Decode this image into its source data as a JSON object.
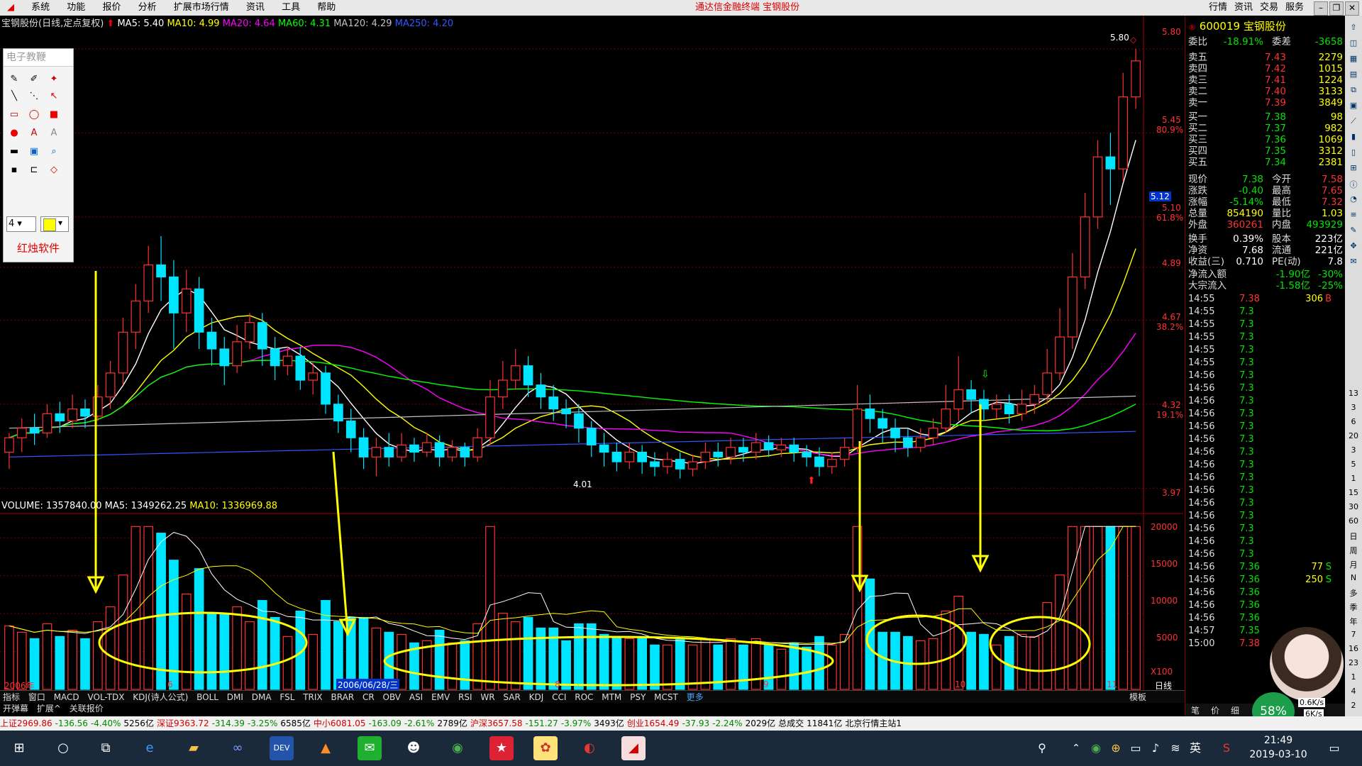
{
  "menubar": {
    "items": [
      "系统",
      "功能",
      "报价",
      "分析",
      "扩展市场行情",
      "资讯",
      "工具",
      "帮助"
    ],
    "center_text": "通达信金融终端  宝钢股份",
    "right_items": [
      "行情",
      "资讯",
      "交易",
      "服务"
    ]
  },
  "chart_header": {
    "title": "宝钢股份(日线,定点复权)",
    "ma5": "MA5: 5.40",
    "ma10": "MA10: 4.99",
    "ma20": "MA20: 4.64",
    "ma60": "MA60: 4.31",
    "ma120": "MA120: 4.29",
    "ma250": "MA250: 4.20",
    "colors": {
      "ma5": "#ffffff",
      "ma10": "#ffff00",
      "ma20": "#ff00ff",
      "ma60": "#00ff00",
      "ma120": "#c0c0c0",
      "ma250": "#3355ff"
    }
  },
  "volume_header": {
    "volume": "VOLUME: 1357840.00",
    "ma5": "MA5: 1349262.25",
    "ma10": "MA10: 1336969.88"
  },
  "price_axis": {
    "labels": [
      "5.80",
      "5.45",
      "80.9%",
      "5.12",
      "5.10",
      "61.8%",
      "4.89",
      "4.67",
      "38.2%",
      "4.32",
      "19.1%",
      "3.97"
    ],
    "peak_label": "5.80",
    "low_label": "4.01"
  },
  "volume_axis": {
    "labels": [
      "20000",
      "15000",
      "10000",
      "5000",
      "X100"
    ]
  },
  "date_axis": {
    "labels": [
      "2006年",
      "6",
      "2006/06/28/三",
      "8",
      "9",
      "10",
      "11"
    ],
    "right_label": "日线"
  },
  "draw_toolbar": {
    "title": "电子教鞭",
    "line_width": "4",
    "brand": "红烛软件"
  },
  "quote": {
    "stock_code": "600019",
    "stock_name": "宝钢股份",
    "weibi_label": "委比",
    "weibi": "-18.91%",
    "weicha_label": "委差",
    "weicha": "-3658",
    "sell": [
      {
        "label": "卖五",
        "price": "7.43",
        "vol": "2279"
      },
      {
        "label": "卖四",
        "price": "7.42",
        "vol": "1015"
      },
      {
        "label": "卖三",
        "price": "7.41",
        "vol": "1224"
      },
      {
        "label": "卖二",
        "price": "7.40",
        "vol": "3133"
      },
      {
        "label": "卖一",
        "price": "7.39",
        "vol": "3849"
      }
    ],
    "buy": [
      {
        "label": "买一",
        "price": "7.38",
        "vol": "98"
      },
      {
        "label": "买二",
        "price": "7.37",
        "vol": "982"
      },
      {
        "label": "买三",
        "price": "7.36",
        "vol": "1069"
      },
      {
        "label": "买四",
        "price": "7.35",
        "vol": "3312"
      },
      {
        "label": "买五",
        "price": "7.34",
        "vol": "2381"
      }
    ],
    "stats": [
      {
        "l1": "现价",
        "v1": "7.38",
        "l2": "今开",
        "v2": "7.58"
      },
      {
        "l1": "涨跌",
        "v1": "-0.40",
        "l2": "最高",
        "v2": "7.65"
      },
      {
        "l1": "涨幅",
        "v1": "-5.14%",
        "l2": "最低",
        "v2": "7.32"
      },
      {
        "l1": "总量",
        "v1": "854190",
        "l2": "量比",
        "v2": "1.03"
      },
      {
        "l1": "外盘",
        "v1": "360261",
        "l2": "内盘",
        "v2": "493929"
      },
      {
        "l1": "换手",
        "v1": "0.39%",
        "l2": "股本",
        "v2": "223亿"
      },
      {
        "l1": "净资",
        "v1": "7.68",
        "l2": "流通",
        "v2": "221亿"
      },
      {
        "l1": "收益(三)",
        "v1": "0.710",
        "l2": "PE(动)",
        "v2": "7.8"
      }
    ],
    "flow": [
      {
        "l": "净流入额",
        "v": "-1.90亿",
        "p": "-30%"
      },
      {
        "l": "大宗流入",
        "v": "-1.58亿",
        "p": "-25%"
      }
    ],
    "ticks": [
      {
        "t": "14:55",
        "p": "7.38",
        "v": "306",
        "f": "B"
      },
      {
        "t": "14:55",
        "p": "7.3",
        "v": "",
        "f": ""
      },
      {
        "t": "14:55",
        "p": "7.3",
        "v": "",
        "f": ""
      },
      {
        "t": "14:55",
        "p": "7.3",
        "v": "",
        "f": ""
      },
      {
        "t": "14:55",
        "p": "7.3",
        "v": "",
        "f": ""
      },
      {
        "t": "14:55",
        "p": "7.3",
        "v": "",
        "f": ""
      },
      {
        "t": "14:56",
        "p": "7.3",
        "v": "",
        "f": ""
      },
      {
        "t": "14:56",
        "p": "7.3",
        "v": "",
        "f": ""
      },
      {
        "t": "14:56",
        "p": "7.3",
        "v": "",
        "f": ""
      },
      {
        "t": "14:56",
        "p": "7.3",
        "v": "",
        "f": ""
      },
      {
        "t": "14:56",
        "p": "7.3",
        "v": "",
        "f": ""
      },
      {
        "t": "14:56",
        "p": "7.3",
        "v": "",
        "f": ""
      },
      {
        "t": "14:56",
        "p": "7.3",
        "v": "",
        "f": ""
      },
      {
        "t": "14:56",
        "p": "7.3",
        "v": "",
        "f": ""
      },
      {
        "t": "14:56",
        "p": "7.3",
        "v": "",
        "f": ""
      },
      {
        "t": "14:56",
        "p": "7.3",
        "v": "",
        "f": ""
      },
      {
        "t": "14:56",
        "p": "7.3",
        "v": "",
        "f": ""
      },
      {
        "t": "14:56",
        "p": "7.3",
        "v": "",
        "f": ""
      },
      {
        "t": "14:56",
        "p": "7.3",
        "v": "",
        "f": ""
      },
      {
        "t": "14:56",
        "p": "7.3",
        "v": "",
        "f": ""
      },
      {
        "t": "14:56",
        "p": "7.3",
        "v": "",
        "f": ""
      },
      {
        "t": "14:56",
        "p": "7.36",
        "v": "77",
        "f": "S"
      },
      {
        "t": "14:56",
        "p": "7.36",
        "v": "250",
        "f": "S"
      },
      {
        "t": "14:56",
        "p": "7.36",
        "v": "",
        "f": ""
      },
      {
        "t": "14:56",
        "p": "7.36",
        "v": "",
        "f": ""
      },
      {
        "t": "14:56",
        "p": "7.36",
        "v": "",
        "f": ""
      },
      {
        "t": "14:57",
        "p": "7.35",
        "v": "",
        "f": ""
      },
      {
        "t": "15:00",
        "p": "7.38",
        "v": "",
        "f": ""
      }
    ],
    "tick_right": [
      "13",
      "3",
      "6",
      "20",
      "3",
      "5",
      "1",
      "15",
      "30",
      "60",
      "日",
      "周",
      "月",
      "N",
      "多",
      "季",
      "年",
      "7",
      "16",
      "23",
      "1",
      "4",
      "2"
    ],
    "bottom_tabs": [
      "笔",
      "价",
      "细"
    ],
    "net_speed_up": "0.6K/s",
    "net_speed_down": "6K/s",
    "cpu_pct": "58%"
  },
  "tabbar": {
    "items": [
      "指标",
      "窗口",
      "MACD",
      "VOL-TDX",
      "KDJ(诗人公式)",
      "BOLL",
      "DMI",
      "DMA",
      "FSL",
      "TRIX",
      "BRAR",
      "CR",
      "OBV",
      "ASI",
      "EMV",
      "RSI",
      "WR",
      "SAR",
      "KDJ",
      "CCI",
      "ROC",
      "MTM",
      "PSY",
      "MCST",
      "更多"
    ],
    "right": "模板"
  },
  "tabbar2": {
    "items": [
      "开弹幕",
      "扩展^",
      "关联报价"
    ]
  },
  "statusline": {
    "items": [
      {
        "text": "上证2969.86",
        "c": "red"
      },
      {
        "text": "-136.56",
        "c": "green"
      },
      {
        "text": "-4.40%",
        "c": "green"
      },
      {
        "text": "5256亿",
        "c": "black"
      },
      {
        "text": "深证9363.72",
        "c": "red"
      },
      {
        "text": "-314.39",
        "c": "green"
      },
      {
        "text": "-3.25%",
        "c": "green"
      },
      {
        "text": "6585亿",
        "c": "black"
      },
      {
        "text": "中小6081.05",
        "c": "red"
      },
      {
        "text": "-163.09",
        "c": "green"
      },
      {
        "text": "-2.61%",
        "c": "green"
      },
      {
        "text": "2789亿",
        "c": "black"
      },
      {
        "text": "沪深3657.58",
        "c": "red"
      },
      {
        "text": "-151.27",
        "c": "green"
      },
      {
        "text": "-3.97%",
        "c": "green"
      },
      {
        "text": "3493亿",
        "c": "black"
      },
      {
        "text": "创业1654.49",
        "c": "red"
      },
      {
        "text": "-37.93",
        "c": "green"
      },
      {
        "text": "-2.24%",
        "c": "green"
      },
      {
        "text": "2029亿",
        "c": "black"
      },
      {
        "text": "总成交",
        "c": "black"
      },
      {
        "text": "11841亿",
        "c": "black"
      },
      {
        "text": "北京行情主站1",
        "c": "black"
      }
    ]
  },
  "taskbar": {
    "time": "21:49",
    "date": "2019-03-10",
    "ime": "英"
  },
  "chart_data": {
    "type": "candlestick",
    "price_range": [
      3.97,
      5.8
    ],
    "candles": [
      [
        4.12,
        4.18,
        4.05,
        4.2
      ],
      [
        4.18,
        4.22,
        4.12,
        4.26
      ],
      [
        4.22,
        4.2,
        4.15,
        4.28
      ],
      [
        4.2,
        4.28,
        4.18,
        4.32
      ],
      [
        4.28,
        4.25,
        4.2,
        4.33
      ],
      [
        4.25,
        4.3,
        4.22,
        4.36
      ],
      [
        4.3,
        4.27,
        4.22,
        4.34
      ],
      [
        4.27,
        4.35,
        4.25,
        4.4
      ],
      [
        4.35,
        4.45,
        4.3,
        4.5
      ],
      [
        4.45,
        4.62,
        4.4,
        4.68
      ],
      [
        4.62,
        4.75,
        4.55,
        4.82
      ],
      [
        4.75,
        4.9,
        4.7,
        4.98
      ],
      [
        4.9,
        4.85,
        4.75,
        5.02
      ],
      [
        4.85,
        4.7,
        4.55,
        4.92
      ],
      [
        4.7,
        4.8,
        4.62,
        4.88
      ],
      [
        4.8,
        4.62,
        4.55,
        4.85
      ],
      [
        4.62,
        4.55,
        4.48,
        4.68
      ],
      [
        4.55,
        4.48,
        4.4,
        4.6
      ],
      [
        4.48,
        4.58,
        4.45,
        4.65
      ],
      [
        4.58,
        4.66,
        4.55,
        4.7
      ],
      [
        4.66,
        4.55,
        4.48,
        4.7
      ],
      [
        4.55,
        4.48,
        4.42,
        4.6
      ],
      [
        4.48,
        4.52,
        4.44,
        4.56
      ],
      [
        4.52,
        4.42,
        4.38,
        4.56
      ],
      [
        4.42,
        4.45,
        4.36,
        4.5
      ],
      [
        4.45,
        4.32,
        4.28,
        4.48
      ],
      [
        4.32,
        4.25,
        4.2,
        4.36
      ],
      [
        4.25,
        4.18,
        4.12,
        4.3
      ],
      [
        4.18,
        4.1,
        4.05,
        4.22
      ],
      [
        4.1,
        4.14,
        4.02,
        4.18
      ],
      [
        4.14,
        4.1,
        4.06,
        4.2
      ],
      [
        4.1,
        4.15,
        4.08,
        4.2
      ],
      [
        4.15,
        4.12,
        4.08,
        4.18
      ],
      [
        4.12,
        4.16,
        4.1,
        4.2
      ],
      [
        4.16,
        4.1,
        4.06,
        4.19
      ],
      [
        4.1,
        4.14,
        4.08,
        4.17
      ],
      [
        4.14,
        4.1,
        4.06,
        4.16
      ],
      [
        4.1,
        4.18,
        4.08,
        4.22
      ],
      [
        4.18,
        4.35,
        4.15,
        4.42
      ],
      [
        4.35,
        4.42,
        4.3,
        4.5
      ],
      [
        4.42,
        4.48,
        4.38,
        4.55
      ],
      [
        4.48,
        4.4,
        4.35,
        4.52
      ],
      [
        4.4,
        4.35,
        4.3,
        4.45
      ],
      [
        4.35,
        4.3,
        4.25,
        4.4
      ],
      [
        4.3,
        4.28,
        4.22,
        4.34
      ],
      [
        4.28,
        4.22,
        4.16,
        4.32
      ],
      [
        4.22,
        4.15,
        4.1,
        4.25
      ],
      [
        4.15,
        4.12,
        4.06,
        4.2
      ],
      [
        4.12,
        4.08,
        4.04,
        4.16
      ],
      [
        4.08,
        4.12,
        4.05,
        4.16
      ],
      [
        4.12,
        4.08,
        4.03,
        4.15
      ],
      [
        4.08,
        4.06,
        4.02,
        4.12
      ],
      [
        4.06,
        4.09,
        4.03,
        4.12
      ],
      [
        4.09,
        4.05,
        4.01,
        4.12
      ],
      [
        4.05,
        4.08,
        4.02,
        4.11
      ],
      [
        4.08,
        4.12,
        4.05,
        4.16
      ],
      [
        4.12,
        4.1,
        4.06,
        4.16
      ],
      [
        4.1,
        4.14,
        4.07,
        4.18
      ],
      [
        4.14,
        4.12,
        4.08,
        4.18
      ],
      [
        4.12,
        4.16,
        4.09,
        4.2
      ],
      [
        4.16,
        4.13,
        4.1,
        4.19
      ],
      [
        4.13,
        4.15,
        4.1,
        4.18
      ],
      [
        4.15,
        4.12,
        4.08,
        4.18
      ],
      [
        4.12,
        4.1,
        4.06,
        4.15
      ],
      [
        4.1,
        4.06,
        4.02,
        4.14
      ],
      [
        4.06,
        4.09,
        4.03,
        4.12
      ],
      [
        4.09,
        4.14,
        4.06,
        4.18
      ],
      [
        4.14,
        4.3,
        4.12,
        4.4
      ],
      [
        4.3,
        4.26,
        4.2,
        4.36
      ],
      [
        4.26,
        4.22,
        4.16,
        4.3
      ],
      [
        4.22,
        4.18,
        4.12,
        4.26
      ],
      [
        4.18,
        4.14,
        4.1,
        4.22
      ],
      [
        4.14,
        4.18,
        4.12,
        4.22
      ],
      [
        4.18,
        4.22,
        4.15,
        4.26
      ],
      [
        4.22,
        4.3,
        4.2,
        4.4
      ],
      [
        4.3,
        4.38,
        4.25,
        4.52
      ],
      [
        4.38,
        4.34,
        4.28,
        4.42
      ],
      [
        4.34,
        4.3,
        4.25,
        4.38
      ],
      [
        4.3,
        4.32,
        4.26,
        4.36
      ],
      [
        4.32,
        4.28,
        4.24,
        4.36
      ],
      [
        4.28,
        4.32,
        4.25,
        4.38
      ],
      [
        4.32,
        4.36,
        4.28,
        4.4
      ],
      [
        4.36,
        4.45,
        4.32,
        4.55
      ],
      [
        4.45,
        4.6,
        4.42,
        4.72
      ],
      [
        4.6,
        4.85,
        4.55,
        4.95
      ],
      [
        4.85,
        5.1,
        4.8,
        5.2
      ],
      [
        5.1,
        5.35,
        5.05,
        5.42
      ],
      [
        5.35,
        5.3,
        5.15,
        5.45
      ],
      [
        5.3,
        5.6,
        5.25,
        5.7
      ],
      [
        5.6,
        5.75,
        5.55,
        5.8
      ]
    ],
    "annotations": {
      "arrows": 5,
      "ellipses": 4,
      "arrow_color": "#ffff00"
    }
  }
}
